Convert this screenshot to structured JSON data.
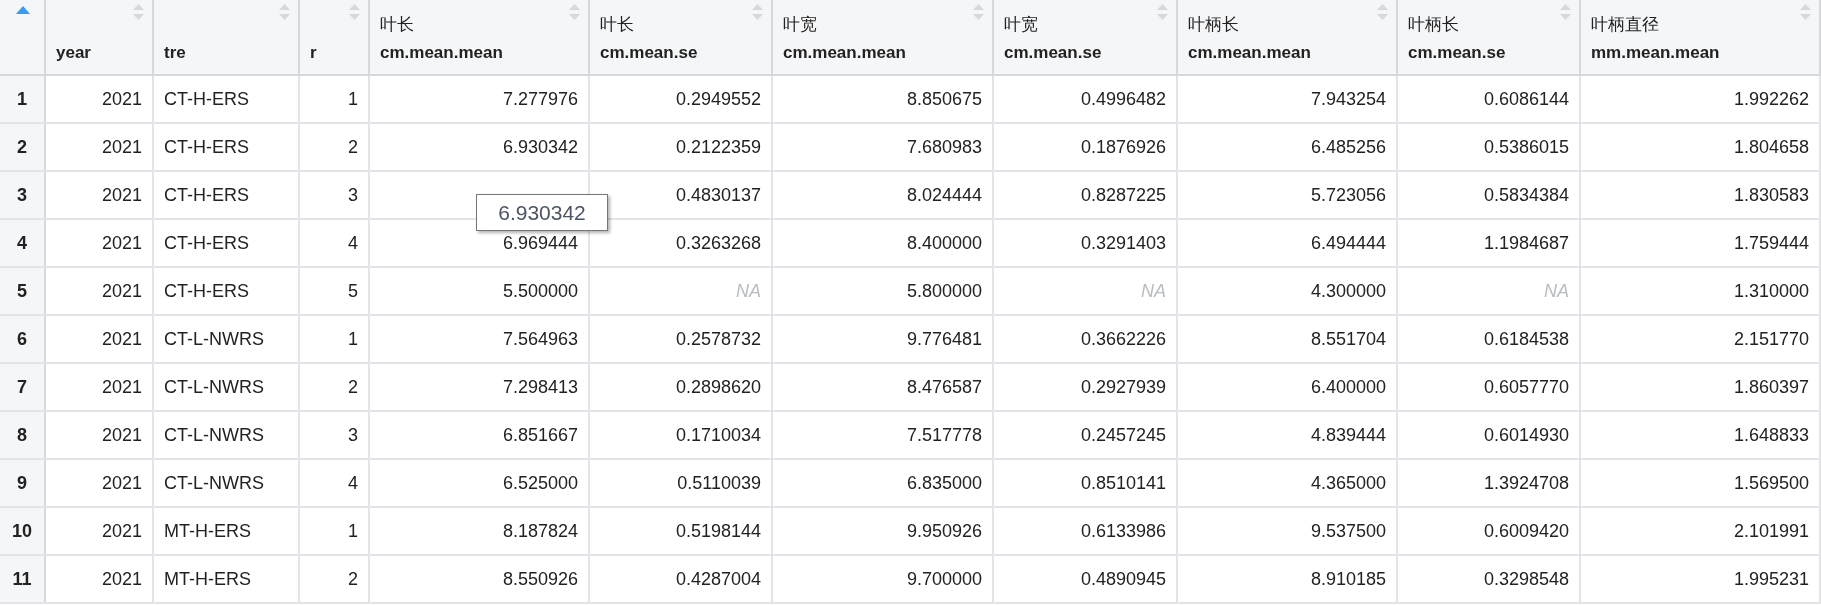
{
  "index_column": {
    "sorted": true
  },
  "columns": [
    {
      "label": "year",
      "sorted": false,
      "kind": "number"
    },
    {
      "label": "tre",
      "sorted": false,
      "kind": "text"
    },
    {
      "label": "r",
      "sorted": false,
      "kind": "number"
    },
    {
      "title": "叶长",
      "label": "cm.mean.mean",
      "sorted": false,
      "kind": "number"
    },
    {
      "title": "叶长",
      "label": "cm.mean.se",
      "sorted": false,
      "kind": "number"
    },
    {
      "title": "叶宽",
      "label": "cm.mean.mean",
      "sorted": false,
      "kind": "number"
    },
    {
      "title": "叶宽",
      "label": "cm.mean.se",
      "sorted": false,
      "kind": "number"
    },
    {
      "title": "叶柄长",
      "label": "cm.mean.mean",
      "sorted": false,
      "kind": "number"
    },
    {
      "title": "叶柄长",
      "label": "cm.mean.se",
      "sorted": false,
      "kind": "number"
    },
    {
      "title": "叶柄直径",
      "label": "mm.mean.mean",
      "sorted": false,
      "kind": "number"
    }
  ],
  "rows": [
    {
      "index": "1",
      "cells": [
        {
          "text": "2021",
          "kind": "value"
        },
        {
          "text": "CT-H-ERS",
          "kind": "value"
        },
        {
          "text": "1",
          "kind": "value"
        },
        {
          "text": "7.277976",
          "kind": "value"
        },
        {
          "text": "0.2949552",
          "kind": "value"
        },
        {
          "text": "8.850675",
          "kind": "value"
        },
        {
          "text": "0.4996482",
          "kind": "value"
        },
        {
          "text": "7.943254",
          "kind": "value"
        },
        {
          "text": "0.6086144",
          "kind": "value"
        },
        {
          "text": "1.992262",
          "kind": "value"
        }
      ]
    },
    {
      "index": "2",
      "cells": [
        {
          "text": "2021",
          "kind": "value"
        },
        {
          "text": "CT-H-ERS",
          "kind": "value"
        },
        {
          "text": "2",
          "kind": "value"
        },
        {
          "text": "6.930342",
          "kind": "value"
        },
        {
          "text": "0.2122359",
          "kind": "value"
        },
        {
          "text": "7.680983",
          "kind": "value"
        },
        {
          "text": "0.1876926",
          "kind": "value"
        },
        {
          "text": "6.485256",
          "kind": "value"
        },
        {
          "text": "0.5386015",
          "kind": "value"
        },
        {
          "text": "1.804658",
          "kind": "value"
        }
      ]
    },
    {
      "index": "3",
      "cells": [
        {
          "text": "2021",
          "kind": "value"
        },
        {
          "text": "CT-H-ERS",
          "kind": "value"
        },
        {
          "text": "3",
          "kind": "value"
        },
        {
          "kind": "hidden"
        },
        {
          "text": "0.4830137",
          "kind": "value"
        },
        {
          "text": "8.024444",
          "kind": "value"
        },
        {
          "text": "0.8287225",
          "kind": "value"
        },
        {
          "text": "5.723056",
          "kind": "value"
        },
        {
          "text": "0.5834384",
          "kind": "value"
        },
        {
          "text": "1.830583",
          "kind": "value"
        }
      ]
    },
    {
      "index": "4",
      "cells": [
        {
          "text": "2021",
          "kind": "value"
        },
        {
          "text": "CT-H-ERS",
          "kind": "value"
        },
        {
          "text": "4",
          "kind": "value"
        },
        {
          "text": "6.969444",
          "kind": "value"
        },
        {
          "text": "0.3263268",
          "kind": "value"
        },
        {
          "text": "8.400000",
          "kind": "value"
        },
        {
          "text": "0.3291403",
          "kind": "value"
        },
        {
          "text": "6.494444",
          "kind": "value"
        },
        {
          "text": "1.1984687",
          "kind": "value"
        },
        {
          "text": "1.759444",
          "kind": "value"
        }
      ]
    },
    {
      "index": "5",
      "cells": [
        {
          "text": "2021",
          "kind": "value"
        },
        {
          "text": "CT-H-ERS",
          "kind": "value"
        },
        {
          "text": "5",
          "kind": "value"
        },
        {
          "text": "5.500000",
          "kind": "value"
        },
        {
          "text": "NA",
          "kind": "na"
        },
        {
          "text": "5.800000",
          "kind": "value"
        },
        {
          "text": "NA",
          "kind": "na"
        },
        {
          "text": "4.300000",
          "kind": "value"
        },
        {
          "text": "NA",
          "kind": "na"
        },
        {
          "text": "1.310000",
          "kind": "value"
        }
      ]
    },
    {
      "index": "6",
      "cells": [
        {
          "text": "2021",
          "kind": "value"
        },
        {
          "text": "CT-L-NWRS",
          "kind": "value"
        },
        {
          "text": "1",
          "kind": "value"
        },
        {
          "text": "7.564963",
          "kind": "value"
        },
        {
          "text": "0.2578732",
          "kind": "value"
        },
        {
          "text": "9.776481",
          "kind": "value"
        },
        {
          "text": "0.3662226",
          "kind": "value"
        },
        {
          "text": "8.551704",
          "kind": "value"
        },
        {
          "text": "0.6184538",
          "kind": "value"
        },
        {
          "text": "2.151770",
          "kind": "value"
        }
      ]
    },
    {
      "index": "7",
      "cells": [
        {
          "text": "2021",
          "kind": "value"
        },
        {
          "text": "CT-L-NWRS",
          "kind": "value"
        },
        {
          "text": "2",
          "kind": "value"
        },
        {
          "text": "7.298413",
          "kind": "value"
        },
        {
          "text": "0.2898620",
          "kind": "value"
        },
        {
          "text": "8.476587",
          "kind": "value"
        },
        {
          "text": "0.2927939",
          "kind": "value"
        },
        {
          "text": "6.400000",
          "kind": "value"
        },
        {
          "text": "0.6057770",
          "kind": "value"
        },
        {
          "text": "1.860397",
          "kind": "value"
        }
      ]
    },
    {
      "index": "8",
      "cells": [
        {
          "text": "2021",
          "kind": "value"
        },
        {
          "text": "CT-L-NWRS",
          "kind": "value"
        },
        {
          "text": "3",
          "kind": "value"
        },
        {
          "text": "6.851667",
          "kind": "value"
        },
        {
          "text": "0.1710034",
          "kind": "value"
        },
        {
          "text": "7.517778",
          "kind": "value"
        },
        {
          "text": "0.2457245",
          "kind": "value"
        },
        {
          "text": "4.839444",
          "kind": "value"
        },
        {
          "text": "0.6014930",
          "kind": "value"
        },
        {
          "text": "1.648833",
          "kind": "value"
        }
      ]
    },
    {
      "index": "9",
      "cells": [
        {
          "text": "2021",
          "kind": "value"
        },
        {
          "text": "CT-L-NWRS",
          "kind": "value"
        },
        {
          "text": "4",
          "kind": "value"
        },
        {
          "text": "6.525000",
          "kind": "value"
        },
        {
          "text": "0.5110039",
          "kind": "value"
        },
        {
          "text": "6.835000",
          "kind": "value"
        },
        {
          "text": "0.8510141",
          "kind": "value"
        },
        {
          "text": "4.365000",
          "kind": "value"
        },
        {
          "text": "1.3924708",
          "kind": "value"
        },
        {
          "text": "1.569500",
          "kind": "value"
        }
      ]
    },
    {
      "index": "10",
      "cells": [
        {
          "text": "2021",
          "kind": "value"
        },
        {
          "text": "MT-H-ERS",
          "kind": "value"
        },
        {
          "text": "1",
          "kind": "value"
        },
        {
          "text": "8.187824",
          "kind": "value"
        },
        {
          "text": "0.5198144",
          "kind": "value"
        },
        {
          "text": "9.950926",
          "kind": "value"
        },
        {
          "text": "0.6133986",
          "kind": "value"
        },
        {
          "text": "9.537500",
          "kind": "value"
        },
        {
          "text": "0.6009420",
          "kind": "value"
        },
        {
          "text": "2.101991",
          "kind": "value"
        }
      ]
    },
    {
      "index": "11",
      "cells": [
        {
          "text": "2021",
          "kind": "value"
        },
        {
          "text": "MT-H-ERS",
          "kind": "value"
        },
        {
          "text": "2",
          "kind": "value"
        },
        {
          "text": "8.550926",
          "kind": "value"
        },
        {
          "text": "0.4287004",
          "kind": "value"
        },
        {
          "text": "9.700000",
          "kind": "value"
        },
        {
          "text": "0.4890945",
          "kind": "value"
        },
        {
          "text": "8.910185",
          "kind": "value"
        },
        {
          "text": "0.3298548",
          "kind": "value"
        },
        {
          "text": "1.995231",
          "kind": "value"
        }
      ]
    }
  ],
  "tooltip": {
    "text": "6.930342"
  }
}
